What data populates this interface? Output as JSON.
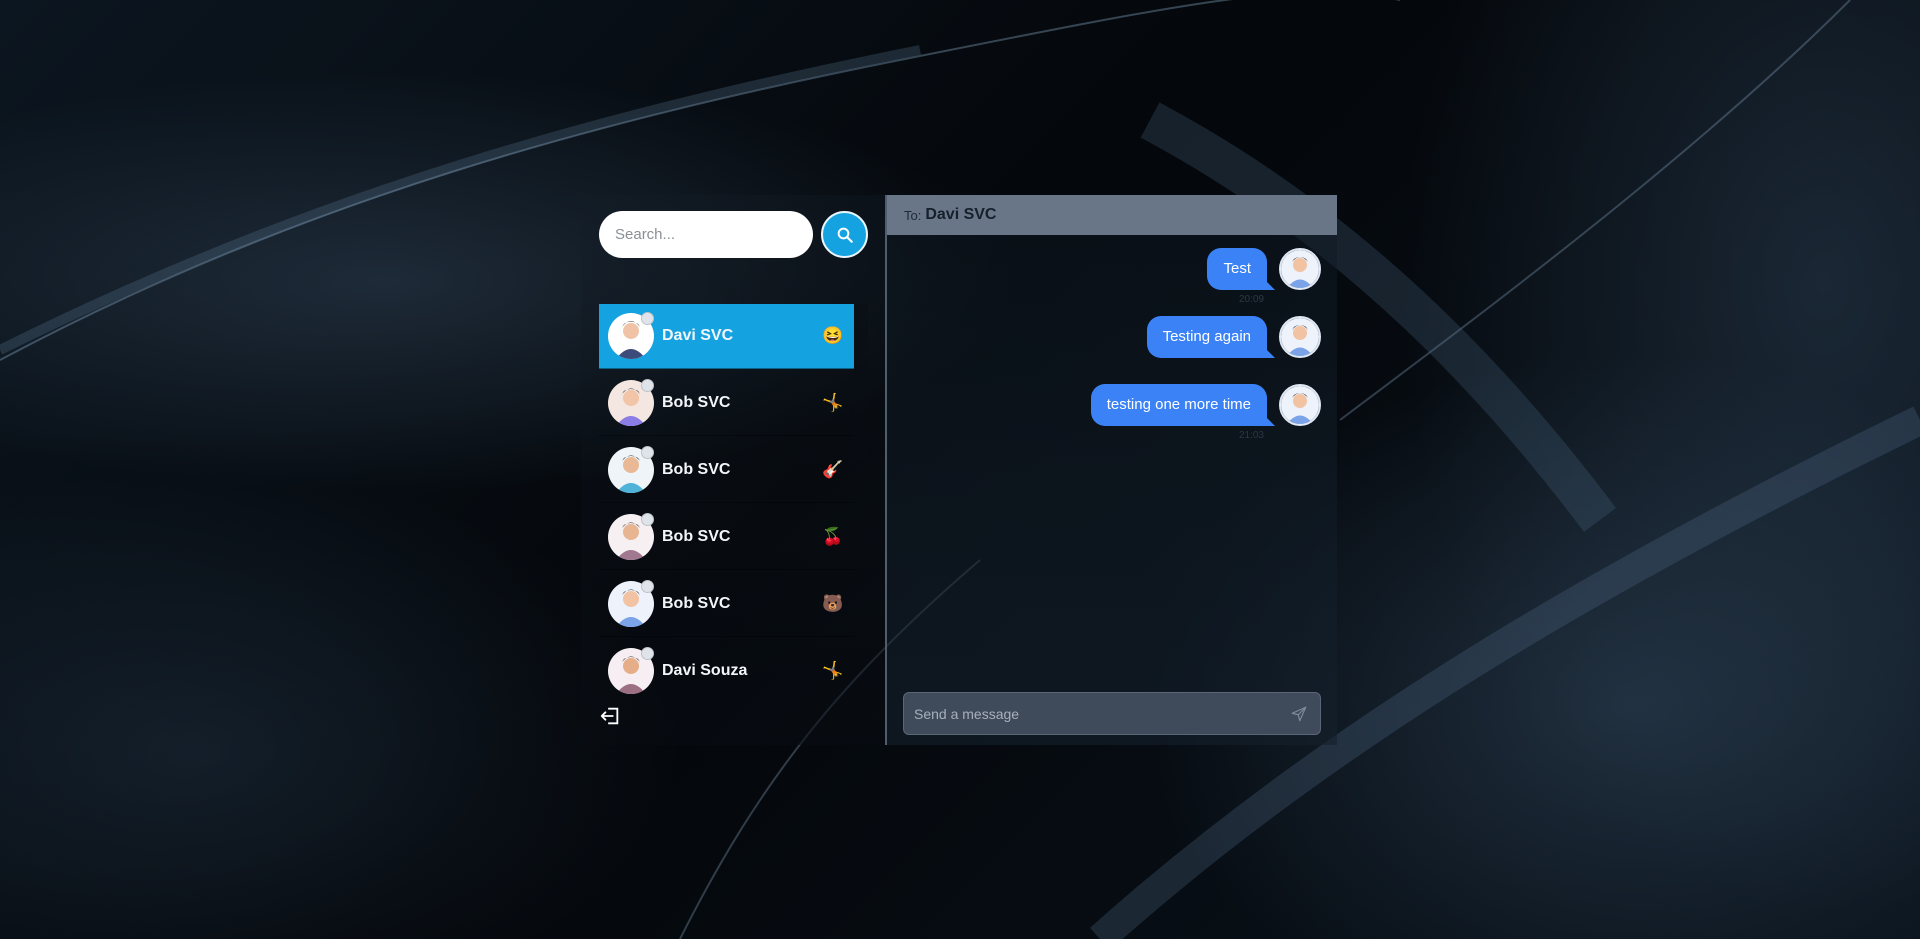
{
  "sidebar": {
    "search_placeholder": "Search...",
    "contacts": [
      {
        "name": "Davi SVC",
        "emoji": "😆",
        "active": true
      },
      {
        "name": "Bob SVC",
        "emoji": "🤸",
        "active": false
      },
      {
        "name": "Bob SVC",
        "emoji": "🎸",
        "active": false
      },
      {
        "name": "Bob SVC",
        "emoji": "🍒",
        "active": false
      },
      {
        "name": "Bob SVC",
        "emoji": "🐻",
        "active": false
      },
      {
        "name": "Davi Souza",
        "emoji": "🤸",
        "active": false
      }
    ]
  },
  "chat": {
    "to_label": "To:",
    "to_name": "Davi SVC",
    "messages": [
      {
        "text": "Test",
        "time": "20:09"
      },
      {
        "text": "Testing again",
        "time": ""
      },
      {
        "text": "testing one more time",
        "time": "21:03"
      }
    ],
    "send_placeholder": "Send a message"
  },
  "colors": {
    "accent": "#14a3e0",
    "bubble": "#3b82f6",
    "header": "#687688"
  }
}
